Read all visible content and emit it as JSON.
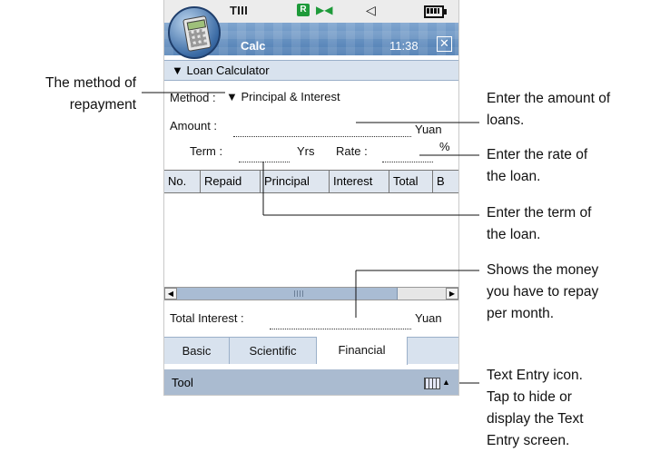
{
  "app": {
    "title": "Calc",
    "clock": "11:38",
    "section_label": "Loan Calculator"
  },
  "status": {
    "signal": "T",
    "r_badge": "R"
  },
  "form": {
    "method_label": "Method :",
    "method_value": "Principal & Interest",
    "amount_label": "Amount :",
    "amount_unit": "Yuan",
    "term_label": "Term :",
    "term_unit": "Yrs",
    "rate_label": "Rate :",
    "rate_unit": "%"
  },
  "table": {
    "columns": [
      "No.",
      "Repaid",
      "Principal",
      "Interest",
      "Total",
      "B"
    ]
  },
  "summary": {
    "total_interest_label": "Total Interest :",
    "total_interest_unit": "Yuan"
  },
  "tabs": [
    {
      "label": "Basic"
    },
    {
      "label": "Scientific"
    },
    {
      "label": "Financial",
      "active": true
    }
  ],
  "toolbar": {
    "tool_label": "Tool"
  },
  "callouts": {
    "method": [
      "The method of",
      "repayment"
    ],
    "amount": [
      "Enter the amount of",
      "loans."
    ],
    "rate": [
      "Enter the rate of",
      "the loan."
    ],
    "term": [
      "Enter the term of",
      "the loan."
    ],
    "money": [
      "Shows the money",
      "you have to repay",
      "per month."
    ],
    "text_entry": [
      "Text Entry icon.",
      "Tap to hide or",
      "display the Text",
      "Entry screen."
    ]
  }
}
